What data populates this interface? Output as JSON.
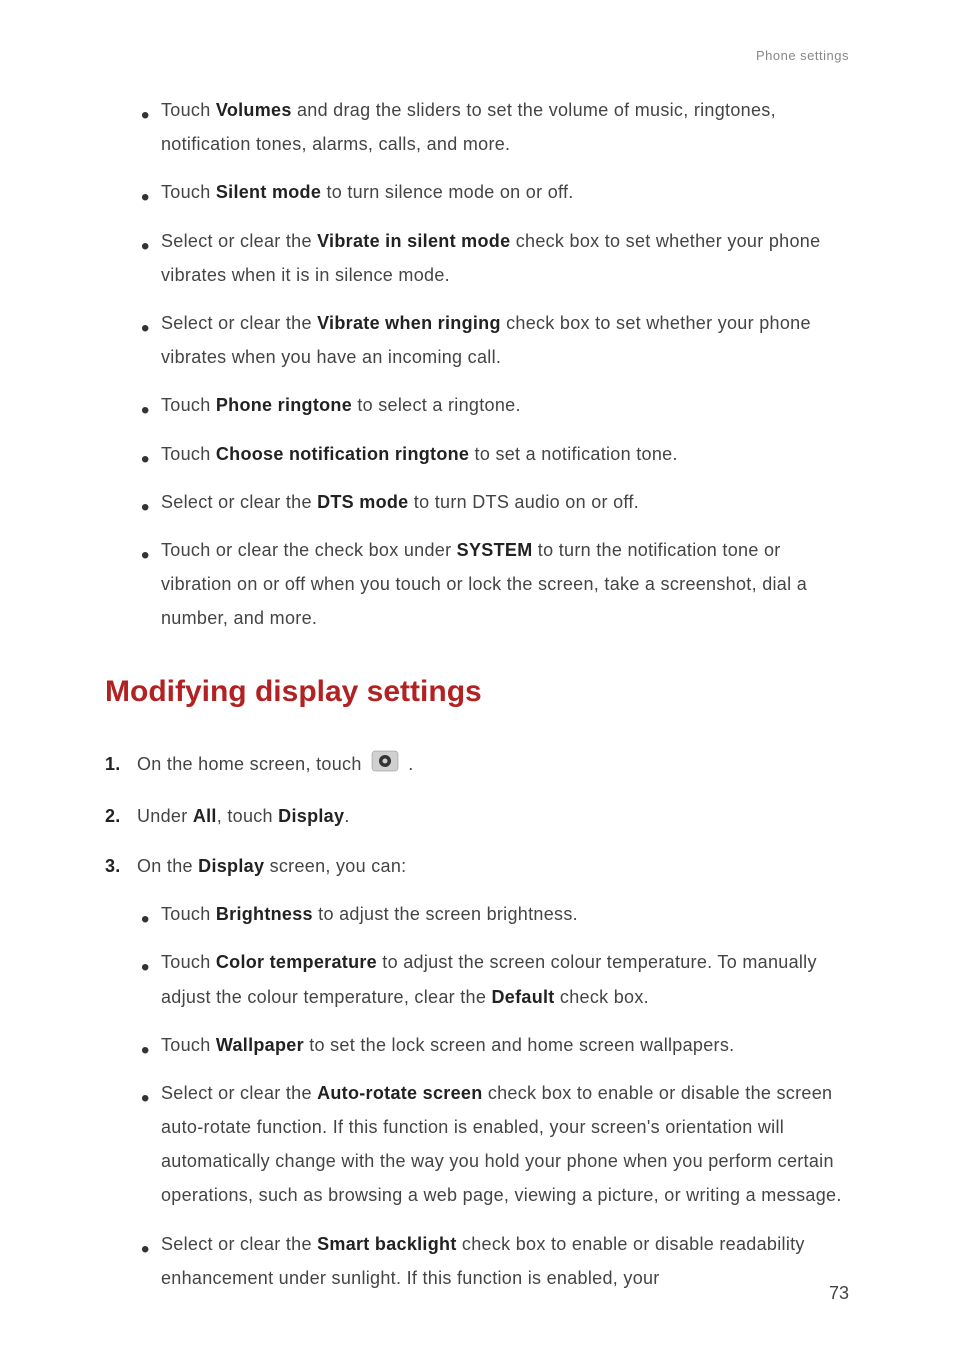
{
  "header": "Phone settings",
  "topBullets": {
    "b1": {
      "t1": "Touch ",
      "bold": "Volumes",
      "t2": " and drag the sliders to set the volume of music, ringtones, notification tones, alarms, calls, and more."
    },
    "b2": {
      "t1": "Touch ",
      "bold": "Silent mode",
      "t2": " to turn silence mode on or off."
    },
    "b3": {
      "t1": "Select or clear the ",
      "bold": "Vibrate in silent mode",
      "t2": " check box to set whether your phone vibrates when it is in silence mode."
    },
    "b4": {
      "t1": "Select or clear the ",
      "bold": "Vibrate when ringing",
      "t2": " check box to set whether your phone vibrates when you have an incoming call."
    },
    "b5": {
      "t1": "Touch ",
      "bold": "Phone ringtone",
      "t2": " to select a ringtone."
    },
    "b6": {
      "t1": "Touch ",
      "bold": "Choose notification ringtone",
      "t2": " to set a notification tone."
    },
    "b7": {
      "t1": "Select or clear the ",
      "bold": "DTS mode",
      "t2": " to turn DTS audio on or off."
    },
    "b8": {
      "t1": "Touch or clear the check box under ",
      "bold": "SYSTEM",
      "t2": " to turn the notification tone or vibration on or off when you touch or lock the screen, take a screenshot, dial a number, and more."
    }
  },
  "sectionTitle": "Modifying display settings",
  "steps": {
    "s1": {
      "num": "1. ",
      "t1": "On the home screen, touch ",
      "t2": " ."
    },
    "s2": {
      "num": "2. ",
      "t1": "Under ",
      "bold1": "All",
      "t2": ", touch ",
      "bold2": "Display",
      "t3": "."
    },
    "s3": {
      "num": "3. ",
      "t1": "On the ",
      "bold": "Display",
      "t2": " screen, you can:"
    }
  },
  "stepBullets": {
    "b1": {
      "t1": "Touch ",
      "bold": "Brightness",
      "t2": " to adjust the screen brightness."
    },
    "b2": {
      "t1": "Touch ",
      "bold1": "Color temperature",
      "t2": " to adjust the screen colour temperature. To manually adjust the colour temperature, clear the ",
      "bold2": "Default",
      "t3": " check box."
    },
    "b3": {
      "t1": "Touch ",
      "bold": "Wallpaper",
      "t2": " to set the lock screen and home screen wallpapers."
    },
    "b4": {
      "t1": "Select or clear the ",
      "bold": "Auto-rotate screen",
      "t2": " check box to enable or disable the screen auto-rotate function. If this function is enabled, your screen's orientation will automatically change with the way you hold your phone when you perform certain operations, such as browsing a web page, viewing a picture, or writing a message."
    },
    "b5": {
      "t1": "Select or clear the ",
      "bold": "Smart backlight",
      "t2": " check box to enable or disable readability enhancement under sunlight. If this function is enabled, your"
    }
  },
  "pageNumber": "73"
}
